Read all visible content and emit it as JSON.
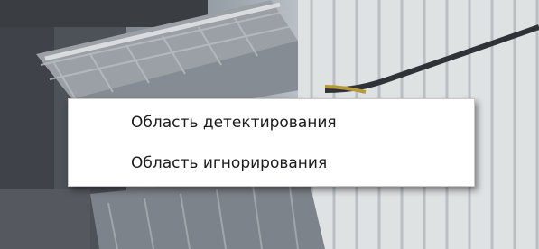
{
  "camera_view": {
    "scene": "video-frame"
  },
  "context_menu": {
    "items": [
      {
        "label": "Область детектирования"
      },
      {
        "label": "Область игнорирования"
      }
    ]
  }
}
